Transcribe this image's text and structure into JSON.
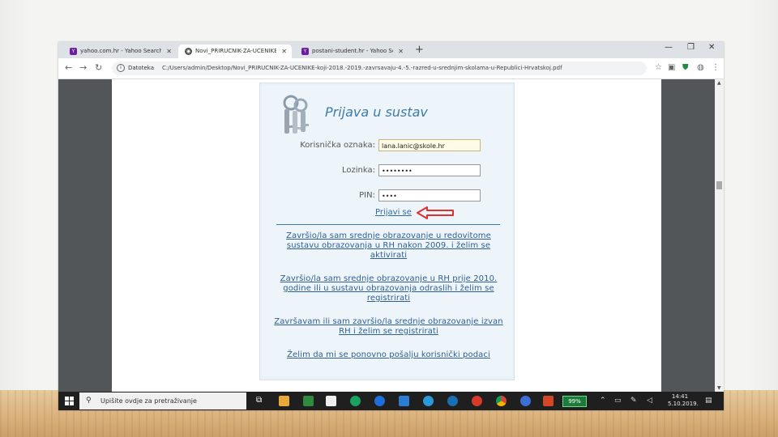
{
  "tabs": [
    {
      "title": "yahoo.com.hr - Yahoo Search Re",
      "favicon": "yahoo-icon"
    },
    {
      "title": "Novi_PRIRUCNIK-ZA-UCENIKE-I",
      "favicon": "globe-icon",
      "active": true
    },
    {
      "title": "postani-student.hr - Yahoo Search",
      "favicon": "yahoo-icon"
    }
  ],
  "address": {
    "label": "Datoteka",
    "url": "C:/Users/admin/Desktop/Novi_PRIRUCNIK-ZA-UCENIKE-koji-2018.-2019.-zavrsavaju-4.-5.-razred-u-srednjim-skolama-u-Republici-Hrvatskoj.pdf"
  },
  "login": {
    "title": "Prijava u sustav",
    "username_label": "Korisnička oznaka:",
    "username_value": "lana.lanic@skole.hr",
    "password_label": "Lozinka:",
    "password_value": "••••••••",
    "pin_label": "PIN:",
    "pin_value": "••••",
    "login_link": "Prijavi se",
    "options": [
      "Završio/la sam srednje obrazovanje u redovitome sustavu obrazovanja u RH nakon 2009. i želim se aktivirati",
      "Završio/la sam srednje obrazovanje u RH prije 2010. godine ili u sustavu obrazovanja odraslih i želim se registrirati",
      "Završavam ili sam završio/la srednje obrazovanje izvan RH i želim se registrirati",
      "Želim da mi se ponovno pošalju korisnički podaci"
    ]
  },
  "taskbar": {
    "search_placeholder": "Upišite ovdje za pretraživanje",
    "battery": "99%",
    "time": "14:41",
    "date": "5.10.2019."
  },
  "colors": {
    "accent": "#3e7ba8",
    "link": "#2e5f92",
    "arrow": "#e03030",
    "taskbar": "#1f1f1f"
  }
}
